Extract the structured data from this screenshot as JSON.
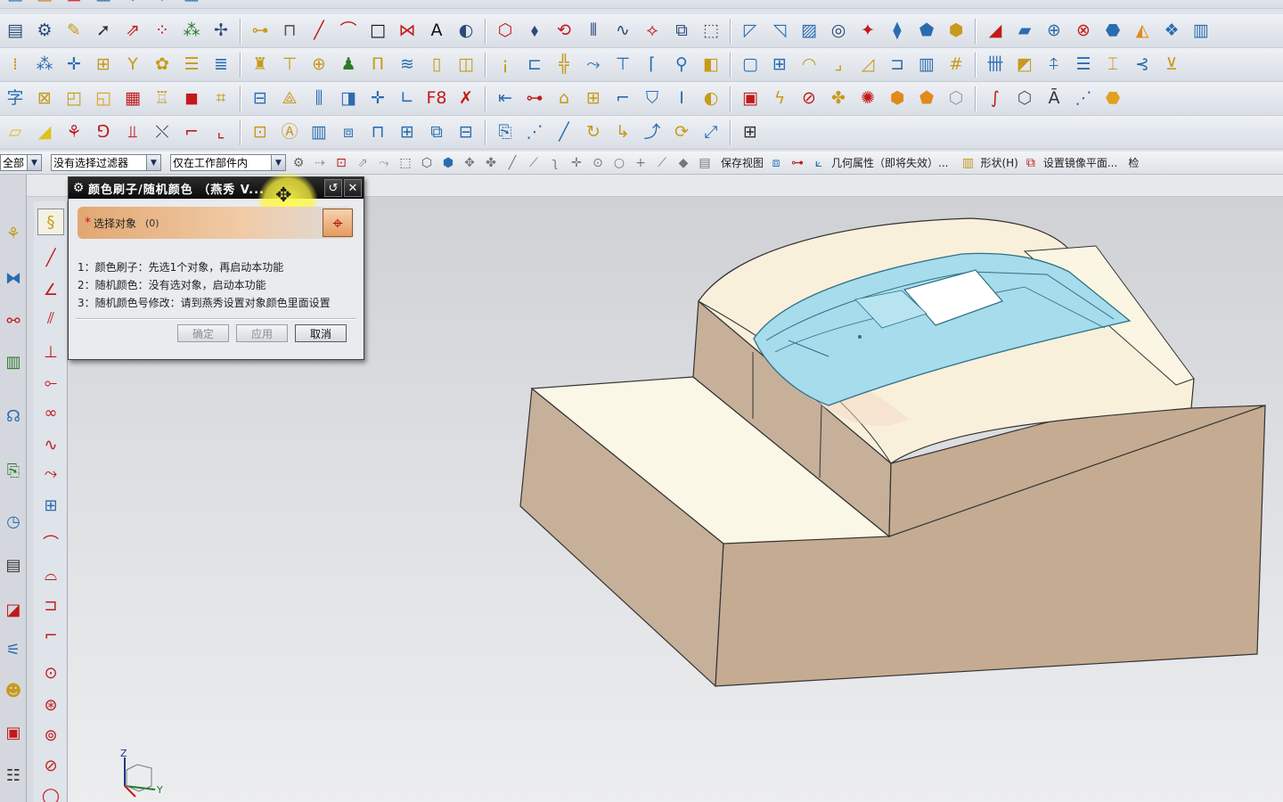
{
  "toolbar_rows": [
    {
      "name": "top-partial-row",
      "icons": [
        {
          "glyph": "▤",
          "color": "#2b6cb0",
          "name": "part-nav-icon"
        },
        {
          "glyph": "▣",
          "color": "#c77a1b",
          "name": "assembly-icon"
        },
        {
          "glyph": "▲",
          "color": "#d33",
          "name": "nx5-icon"
        },
        {
          "glyph": "▦",
          "color": "#2b6cb0",
          "name": "layer-icon"
        },
        {
          "glyph": "◆",
          "color": "#3b7fc4",
          "name": "solid-icon"
        },
        {
          "glyph": "◈",
          "color": "#c77a1b",
          "name": "feature-icon"
        },
        {
          "glyph": "▥",
          "color": "#2b6cb0",
          "name": "sheet-icon"
        }
      ]
    },
    {
      "name": "standard-row",
      "icons": [
        {
          "glyph": "▤",
          "color": "#2b4a7a",
          "name": "layer-settings-icon"
        },
        {
          "glyph": "⚙",
          "color": "#2b4a7a",
          "name": "preferences-icon"
        },
        {
          "glyph": "✎",
          "color": "#c79a1b",
          "name": "edit-icon"
        },
        {
          "glyph": "➚",
          "color": "#333",
          "name": "select-arrow-icon"
        },
        {
          "glyph": "⇗",
          "color": "#c21a1a",
          "name": "move-icon"
        },
        {
          "glyph": "⁘",
          "color": "#c21a1a",
          "name": "point-set-icon"
        },
        {
          "glyph": "⁂",
          "color": "#2b7a2b",
          "name": "point-cloud-icon"
        },
        {
          "glyph": "✢",
          "color": "#2b4a7a",
          "name": "snap-icon"
        },
        {
          "glyph": "⊶",
          "color": "#c79a1b",
          "name": "measure-icon"
        },
        {
          "glyph": "⊓",
          "color": "#555",
          "name": "dimension-icon"
        },
        {
          "glyph": "╱",
          "color": "#c21a1a",
          "name": "line-icon"
        },
        {
          "glyph": "⌒",
          "color": "#c21a1a",
          "name": "arc-icon"
        },
        {
          "glyph": "□",
          "color": "#111",
          "name": "rectangle-icon"
        },
        {
          "glyph": "⋈",
          "color": "#c21a1a",
          "name": "spline-icon"
        },
        {
          "glyph": "A",
          "color": "#111",
          "name": "text-icon"
        },
        {
          "glyph": "◐",
          "color": "#2b4a7a",
          "name": "offset-icon"
        },
        {
          "glyph": "⬡",
          "color": "#c21a1a",
          "name": "polygon-icon"
        },
        {
          "glyph": "⬧",
          "color": "#2b4a7a",
          "name": "project-icon"
        },
        {
          "glyph": "⟲",
          "color": "#c21a1a",
          "name": "rotate-icon"
        },
        {
          "glyph": "⫴",
          "color": "#2b4a7a",
          "name": "split-icon"
        },
        {
          "glyph": "∿",
          "color": "#2b4a7a",
          "name": "wave-icon"
        },
        {
          "glyph": "⟡",
          "color": "#c21a1a",
          "name": "bridge-icon"
        },
        {
          "glyph": "⧉",
          "color": "#2b4a7a",
          "name": "copy-icon"
        },
        {
          "glyph": "⬚",
          "color": "#555",
          "name": "box-icon"
        },
        {
          "glyph": "◸",
          "color": "#2b6cb0",
          "name": "surface-1-icon"
        },
        {
          "glyph": "◹",
          "color": "#2b6cb0",
          "name": "surface-2-icon"
        },
        {
          "glyph": "▨",
          "color": "#2b6cb0",
          "name": "mesh-icon"
        },
        {
          "glyph": "◎",
          "color": "#2b4a7a",
          "name": "view-orient-icon"
        },
        {
          "glyph": "✦",
          "color": "#c21a1a",
          "name": "sparkle-icon"
        },
        {
          "glyph": "⧫",
          "color": "#2b6cb0",
          "name": "sew-icon"
        },
        {
          "glyph": "⬟",
          "color": "#2b6cb0",
          "name": "patch-icon"
        },
        {
          "glyph": "⬢",
          "color": "#c79a1b",
          "name": "body-icon"
        },
        {
          "glyph": "◢",
          "color": "#c21a1a",
          "name": "trim-icon"
        },
        {
          "glyph": "▰",
          "color": "#2b6cb0",
          "name": "thicken-icon"
        },
        {
          "glyph": "⊕",
          "color": "#2b6cb0",
          "name": "unite-icon"
        },
        {
          "glyph": "⊗",
          "color": "#c21a1a",
          "name": "subtract-icon"
        },
        {
          "glyph": "⬣",
          "color": "#2b6cb0",
          "name": "shell-icon"
        },
        {
          "glyph": "◭",
          "color": "#e08a1b",
          "name": "draft-icon"
        },
        {
          "glyph": "❖",
          "color": "#2b6cb0",
          "name": "pattern-icon"
        },
        {
          "glyph": "▥",
          "color": "#2b6cb0",
          "name": "book-icon"
        }
      ]
    },
    {
      "name": "mold-row",
      "icons": [
        {
          "glyph": "⁞",
          "color": "#c79a1b",
          "name": "grid-icon"
        },
        {
          "glyph": "⁂",
          "color": "#2b6cb0",
          "name": "dots-icon"
        },
        {
          "glyph": "✛",
          "color": "#2b6cb0",
          "name": "cross-icon"
        },
        {
          "glyph": "⊞",
          "color": "#c79a1b",
          "name": "frame-icon"
        },
        {
          "glyph": "Y",
          "color": "#c79a1b",
          "name": "y-frame-icon"
        },
        {
          "glyph": "✿",
          "color": "#c79a1b",
          "name": "gear-frame-icon"
        },
        {
          "glyph": "☰",
          "color": "#c79a1b",
          "name": "plate-stack-icon"
        },
        {
          "glyph": "≣",
          "color": "#2b6cb0",
          "name": "plate-icon"
        },
        {
          "glyph": "♜",
          "color": "#c79a1b",
          "name": "pin-icon"
        },
        {
          "glyph": "⊤",
          "color": "#c79a1b",
          "name": "ejector-icon"
        },
        {
          "glyph": "⊕",
          "color": "#c79a1b",
          "name": "gate-icon"
        },
        {
          "glyph": "♟",
          "color": "#2b7a2b",
          "name": "sprue-icon"
        },
        {
          "glyph": "Π",
          "color": "#c79a1b",
          "name": "slider-icon"
        },
        {
          "glyph": "≋",
          "color": "#2b6cb0",
          "name": "cooling-icon"
        },
        {
          "glyph": "▯",
          "color": "#c79a1b",
          "name": "insert-icon"
        },
        {
          "glyph": "◫",
          "color": "#c79a1b",
          "name": "pocket-icon"
        },
        {
          "glyph": "¡",
          "color": "#c79a1b",
          "name": "screw-icon"
        },
        {
          "glyph": "⊏",
          "color": "#2b6cb0",
          "name": "bracket-icon"
        },
        {
          "glyph": "╬",
          "color": "#c79a1b",
          "name": "rib-icon"
        },
        {
          "glyph": "⤳",
          "color": "#2b6cb0",
          "name": "runner-icon"
        },
        {
          "glyph": "⊤",
          "color": "#2b6cb0",
          "name": "tee-icon"
        },
        {
          "glyph": "⌈",
          "color": "#2b6cb0",
          "name": "corner-icon"
        },
        {
          "glyph": "⚲",
          "color": "#2b6cb0",
          "name": "locate-icon"
        },
        {
          "glyph": "◧",
          "color": "#c79a1b",
          "name": "half-block-icon"
        },
        {
          "glyph": "▢",
          "color": "#2b6cb0",
          "name": "block-icon"
        },
        {
          "glyph": "⊞",
          "color": "#2b6cb0",
          "name": "open-icon"
        },
        {
          "glyph": "◠",
          "color": "#c79a1b",
          "name": "dome-icon"
        },
        {
          "glyph": "⌟",
          "color": "#c79a1b",
          "name": "l-shape-icon"
        },
        {
          "glyph": "◿",
          "color": "#c79a1b",
          "name": "chamfer-icon"
        },
        {
          "glyph": "⊐",
          "color": "#2b6cb0",
          "name": "channel-icon"
        },
        {
          "glyph": "▥",
          "color": "#2b6cb0",
          "name": "columns-icon"
        },
        {
          "glyph": "#",
          "color": "#c79a1b",
          "name": "hash-icon"
        },
        {
          "glyph": "卌",
          "color": "#2b6cb0",
          "name": "comb-icon"
        },
        {
          "glyph": "◩",
          "color": "#c79a1b",
          "name": "flag-icon"
        },
        {
          "glyph": "⍏",
          "color": "#2b6cb0",
          "name": "arrow-up-icon"
        },
        {
          "glyph": "☰",
          "color": "#2b6cb0",
          "name": "menu-lines-icon"
        },
        {
          "glyph": "⌶",
          "color": "#c79a1b",
          "name": "beam-icon"
        },
        {
          "glyph": "⊰",
          "color": "#2b6cb0",
          "name": "bend-icon"
        },
        {
          "glyph": "⊻",
          "color": "#c79a1b",
          "name": "merge-icon"
        }
      ]
    },
    {
      "name": "utility-row",
      "icons": [
        {
          "glyph": "字",
          "color": "#2b6cb0",
          "name": "char-icon"
        },
        {
          "glyph": "⊠",
          "color": "#c79a1b",
          "name": "cross-box-icon"
        },
        {
          "glyph": "◰",
          "color": "#c79a1b",
          "name": "box-3d-icon"
        },
        {
          "glyph": "◱",
          "color": "#e0a020",
          "name": "cube-icon"
        },
        {
          "glyph": "▦",
          "color": "#c21a1a",
          "name": "color-grid-icon"
        },
        {
          "glyph": "♖",
          "color": "#c79a1b",
          "name": "brush-icon"
        },
        {
          "glyph": "◼",
          "color": "#c21a1a",
          "name": "red-cube-icon"
        },
        {
          "glyph": "⌗",
          "color": "#c79a1b",
          "name": "frame-grid-icon"
        },
        {
          "glyph": "⊟",
          "color": "#2b6cb0",
          "name": "minus-box-icon"
        },
        {
          "glyph": "⟁",
          "color": "#c79a1b",
          "name": "triangle-icon"
        },
        {
          "glyph": "⫼",
          "color": "#2b6cb0",
          "name": "bars-icon"
        },
        {
          "glyph": "◨",
          "color": "#2b6cb0",
          "name": "half-icon"
        },
        {
          "glyph": "✛",
          "color": "#2b6cb0",
          "name": "plus-icon"
        },
        {
          "glyph": "∟",
          "color": "#2b6cb0",
          "name": "angle-icon"
        },
        {
          "glyph": "F8",
          "color": "#c21a1a",
          "name": "f8-icon"
        },
        {
          "glyph": "✗",
          "color": "#c21a1a",
          "name": "x-icon"
        },
        {
          "glyph": "⇤",
          "color": "#2b6cb0",
          "name": "align-left-icon"
        },
        {
          "glyph": "⊶",
          "color": "#c21a1a",
          "name": "link-icon"
        },
        {
          "glyph": "⌂",
          "color": "#c79a1b",
          "name": "house-icon"
        },
        {
          "glyph": "⊞",
          "color": "#c79a1b",
          "name": "add-box-icon"
        },
        {
          "glyph": "⌐",
          "color": "#2b6cb0",
          "name": "step-icon"
        },
        {
          "glyph": "⛉",
          "color": "#2b6cb0",
          "name": "shield-icon"
        },
        {
          "glyph": "Ⅰ",
          "color": "#2b6cb0",
          "name": "i-beam-icon"
        },
        {
          "glyph": "◐",
          "color": "#c79a1b",
          "name": "contrast-icon"
        },
        {
          "glyph": "▣",
          "color": "#c21a1a",
          "name": "square-icon"
        },
        {
          "glyph": "ϟ",
          "color": "#c79a1b",
          "name": "lightning-icon"
        },
        {
          "glyph": "⊘",
          "color": "#c21a1a",
          "name": "forbid-icon"
        },
        {
          "glyph": "✤",
          "color": "#c79a1b",
          "name": "star-icon"
        },
        {
          "glyph": "✺",
          "color": "#c21a1a",
          "name": "palette-icon"
        },
        {
          "glyph": "⬢",
          "color": "#e08a1b",
          "name": "orange-cube-icon"
        },
        {
          "glyph": "⬟",
          "color": "#e08a1b",
          "name": "orange-face-icon"
        },
        {
          "glyph": "⬡",
          "color": "#999",
          "name": "gray-cube-icon"
        },
        {
          "glyph": "∫",
          "color": "#c21a1a",
          "name": "integral-icon"
        },
        {
          "glyph": "⬡",
          "color": "#555",
          "name": "white-cube-icon"
        },
        {
          "glyph": "Ā",
          "color": "#333",
          "name": "attr-icon"
        },
        {
          "glyph": "⋰",
          "color": "#2b6cb0",
          "name": "diag-icon"
        },
        {
          "glyph": "⬣",
          "color": "#e0a020",
          "name": "yellow-body-icon"
        }
      ]
    },
    {
      "name": "sketch-row",
      "icons": [
        {
          "glyph": "▱",
          "color": "#e0c020",
          "name": "face-icon"
        },
        {
          "glyph": "◢",
          "color": "#e0c020",
          "name": "wedge-icon"
        },
        {
          "glyph": "⚘",
          "color": "#c21a1a",
          "name": "flower-icon"
        },
        {
          "glyph": "⅁",
          "color": "#c21a1a",
          "name": "glyph-icon"
        },
        {
          "glyph": "⫫",
          "color": "#c21a1a",
          "name": "pillars-icon"
        },
        {
          "glyph": "⤬",
          "color": "#333",
          "name": "x-cross-icon"
        },
        {
          "glyph": "⌐",
          "color": "#c21a1a",
          "name": "elbow-icon"
        },
        {
          "glyph": "⌞",
          "color": "#c21a1a",
          "name": "corner-bl-icon"
        },
        {
          "glyph": "⊡",
          "color": "#c79a1b",
          "name": "dot-box-icon"
        },
        {
          "glyph": "Ⓐ",
          "color": "#c79a1b",
          "name": "a-box-icon"
        },
        {
          "glyph": "▥",
          "color": "#2b6cb0",
          "name": "shelf-icon"
        },
        {
          "glyph": "⧈",
          "color": "#2b6cb0",
          "name": "double-box-icon"
        },
        {
          "glyph": "⊓",
          "color": "#2b6cb0",
          "name": "arch-icon"
        },
        {
          "glyph": "⊞",
          "color": "#2b6cb0",
          "name": "quad-icon"
        },
        {
          "glyph": "⧉",
          "color": "#2b6cb0",
          "name": "stack-icon"
        },
        {
          "glyph": "⊟",
          "color": "#2b6cb0",
          "name": "shelves-icon"
        },
        {
          "glyph": "⎘",
          "color": "#2b6cb0",
          "name": "doc-icon"
        },
        {
          "glyph": "⋰",
          "color": "#2b6cb0",
          "name": "dash-line-icon"
        },
        {
          "glyph": "╱",
          "color": "#2b6cb0",
          "name": "slash-icon"
        },
        {
          "glyph": "↻",
          "color": "#c79a1b",
          "name": "refresh-icon"
        },
        {
          "glyph": "↳",
          "color": "#c79a1b",
          "name": "turn-icon"
        },
        {
          "glyph": "⤴",
          "color": "#2b6cb0",
          "name": "up-turn-icon"
        },
        {
          "glyph": "⟳",
          "color": "#c79a1b",
          "name": "cycle-icon"
        },
        {
          "glyph": "⤢",
          "color": "#2b6cb0",
          "name": "diag-arrow-icon"
        },
        {
          "glyph": "⊞",
          "color": "#333",
          "name": "grid4-icon"
        }
      ]
    }
  ],
  "selection_bar": {
    "type_filter": "全部",
    "selection_filter": "没有选择过滤器",
    "scope": "仅在工作部件内",
    "save_view": "保存视图",
    "geometry_props": "几何属性（即将失效）...",
    "shape": "形状(H)",
    "mirror_plane": "设置镜像平面...",
    "trailing": "检"
  },
  "dialog": {
    "title": "颜色刷子/随机颜色 （燕秀 V...",
    "select_label": "选择对象",
    "select_count": "(0)",
    "hint1": "1：颜色刷子：先选1个对象，再启动本功能",
    "hint2": "2：随机颜色：没有选对象，启动本功能",
    "hint3": "3：随机颜色号修改：请到燕秀设置对象颜色里面设置",
    "ok": "确定",
    "apply": "应用",
    "cancel": "取消"
  },
  "triad": {
    "z": "Z",
    "y": "Y"
  },
  "colors": {
    "mold_face": "#c4ab92",
    "mold_top": "#fbf6e4",
    "part_blue": "#a6dceb",
    "dialog_title": "#111111"
  }
}
